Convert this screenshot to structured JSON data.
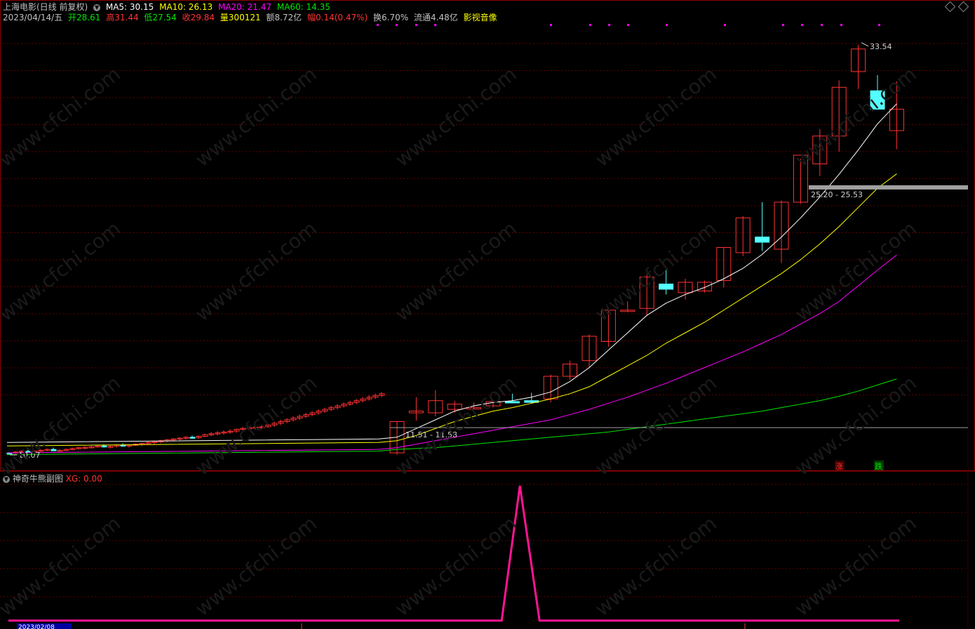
{
  "header": {
    "stock_name": "上海电影(日线 前复权)",
    "ma5": "MA5: 30.15",
    "ma10": "MA10: 26.13",
    "ma20": "MA20: 21.47",
    "ma60": "MA60: 14.35",
    "date": "2023/04/14/五",
    "open": "开28.61",
    "high": "高31.44",
    "low": "低27.54",
    "close": "收29.84",
    "volume": "量300121",
    "amount": "额8.72亿",
    "change": "幅0.14(0.47%)",
    "turnover": "换6.70%",
    "float": "流通4.48亿",
    "sector": "影视音像"
  },
  "sub_panel": {
    "title": "神奇牛熊副图",
    "xg": "XG: 0.00"
  },
  "annotations": {
    "high_mark": "33.54",
    "low_mark": "10.07",
    "zone1": "25.20 - 25.53",
    "zone2": "11.51 - 11.58",
    "up_tag": "涨",
    "down_tag": "跌"
  },
  "watermark": "www.cfchi.com",
  "colors": {
    "bg": "#000000",
    "up": "#ff3232",
    "down": "#54ffff",
    "ma5": "#ffffff",
    "ma10": "#ffff00",
    "ma20": "#ff00ff",
    "ma60": "#00e600",
    "grid": "#600000",
    "sub_line": "#ff1493"
  },
  "chart_data": {
    "type": "candlestick",
    "y_range": [
      9.5,
      34.5
    ],
    "candles": [
      [
        10.1,
        10.15,
        10.05,
        10.07
      ],
      [
        10.1,
        10.2,
        10.05,
        10.15
      ],
      [
        10.15,
        10.25,
        10.1,
        10.2
      ],
      [
        10.2,
        10.3,
        10.1,
        10.18
      ],
      [
        10.18,
        10.25,
        10.1,
        10.2
      ],
      [
        10.2,
        10.3,
        10.15,
        10.25
      ],
      [
        10.25,
        10.35,
        10.2,
        10.3
      ],
      [
        10.3,
        10.4,
        10.2,
        10.22
      ],
      [
        10.22,
        10.3,
        10.15,
        10.25
      ],
      [
        10.25,
        10.35,
        10.2,
        10.3
      ],
      [
        10.3,
        10.4,
        10.25,
        10.35
      ],
      [
        10.35,
        10.45,
        10.3,
        10.4
      ],
      [
        10.4,
        10.5,
        10.3,
        10.42
      ],
      [
        10.42,
        10.5,
        10.35,
        10.45
      ],
      [
        10.45,
        10.55,
        10.4,
        10.5
      ],
      [
        10.5,
        10.6,
        10.4,
        10.45
      ],
      [
        10.45,
        10.55,
        10.35,
        10.48
      ],
      [
        10.48,
        10.6,
        10.4,
        10.55
      ],
      [
        10.55,
        10.65,
        10.45,
        10.5
      ],
      [
        10.5,
        10.6,
        10.4,
        10.55
      ],
      [
        10.55,
        10.65,
        10.5,
        10.6
      ],
      [
        10.6,
        10.7,
        10.5,
        10.65
      ],
      [
        10.65,
        10.75,
        10.55,
        10.7
      ],
      [
        10.7,
        10.8,
        10.6,
        10.75
      ],
      [
        10.75,
        10.85,
        10.65,
        10.8
      ],
      [
        10.8,
        10.9,
        10.7,
        10.85
      ],
      [
        10.85,
        10.95,
        10.75,
        10.9
      ],
      [
        10.9,
        11.0,
        10.8,
        10.95
      ],
      [
        10.95,
        11.05,
        10.85,
        11.0
      ],
      [
        11.0,
        11.1,
        10.9,
        10.98
      ],
      [
        10.98,
        11.1,
        10.9,
        11.05
      ],
      [
        11.05,
        11.2,
        11.0,
        11.15
      ],
      [
        11.15,
        11.3,
        11.05,
        11.2
      ],
      [
        11.2,
        11.35,
        11.1,
        11.25
      ],
      [
        11.25,
        11.4,
        11.15,
        11.3
      ],
      [
        11.3,
        11.45,
        11.2,
        11.35
      ],
      [
        11.35,
        11.5,
        11.25,
        11.45
      ],
      [
        11.45,
        11.58,
        11.4,
        11.51
      ],
      [
        11.51,
        11.6,
        11.4,
        11.55
      ],
      [
        11.55,
        11.65,
        11.45,
        11.58
      ],
      [
        11.58,
        11.7,
        11.45,
        11.6
      ],
      [
        11.6,
        11.8,
        11.55,
        11.7
      ],
      [
        11.7,
        11.9,
        11.6,
        11.8
      ],
      [
        11.8,
        12.0,
        11.7,
        11.9
      ],
      [
        11.9,
        12.1,
        11.8,
        12.0
      ],
      [
        12.0,
        12.2,
        11.9,
        12.1
      ],
      [
        12.1,
        12.3,
        12.0,
        12.2
      ],
      [
        12.2,
        12.4,
        12.1,
        12.3
      ],
      [
        12.3,
        12.5,
        12.2,
        12.4
      ],
      [
        12.4,
        12.6,
        12.3,
        12.5
      ],
      [
        12.5,
        12.7,
        12.4,
        12.6
      ],
      [
        12.6,
        12.8,
        12.5,
        12.7
      ],
      [
        12.7,
        12.9,
        12.6,
        12.8
      ],
      [
        12.8,
        13.0,
        12.7,
        12.9
      ],
      [
        12.9,
        13.1,
        12.8,
        13.0
      ],
      [
        13.0,
        13.2,
        12.9,
        13.1
      ],
      [
        13.1,
        13.3,
        13.0,
        13.2
      ],
      [
        13.2,
        13.4,
        13.1,
        13.3
      ],
      [
        13.3,
        13.5,
        13.2,
        13.4
      ],
      [
        13.4,
        13.6,
        13.3,
        13.5
      ]
    ],
    "candles_main": [
      [
        10.1,
        11.9,
        10.0,
        11.9
      ],
      [
        12.4,
        13.3,
        11.95,
        12.5
      ],
      [
        12.4,
        13.7,
        12.2,
        13.1
      ],
      [
        12.6,
        13.1,
        12.4,
        12.9
      ],
      [
        12.7,
        13.0,
        12.6,
        12.7
      ],
      [
        12.8,
        13.1,
        12.7,
        13.05
      ],
      [
        13.05,
        13.5,
        12.95,
        13.0
      ],
      [
        13.1,
        13.55,
        12.95,
        13.0
      ],
      [
        13.2,
        14.6,
        13.0,
        14.5
      ],
      [
        14.5,
        15.4,
        14.3,
        15.2
      ],
      [
        15.4,
        16.9,
        15.0,
        16.8
      ],
      [
        16.5,
        18.4,
        16.2,
        18.3
      ],
      [
        18.3,
        18.8,
        18.2,
        18.3
      ],
      [
        18.4,
        20.4,
        18.0,
        20.2
      ],
      [
        19.8,
        20.6,
        19.2,
        19.5
      ],
      [
        19.3,
        20.1,
        18.9,
        19.9
      ],
      [
        19.4,
        20.0,
        19.3,
        19.9
      ],
      [
        20.0,
        21.9,
        19.6,
        21.9
      ],
      [
        21.6,
        23.7,
        21.4,
        23.6
      ],
      [
        22.5,
        24.5,
        21.7,
        22.2
      ],
      [
        21.8,
        24.6,
        21.0,
        24.5
      ],
      [
        24.5,
        27.0,
        24.4,
        27.2
      ],
      [
        26.7,
        28.7,
        26.0,
        28.3
      ],
      [
        28.3,
        31.5,
        27.4,
        31.1
      ],
      [
        32.0,
        33.54,
        31.0,
        33.3
      ],
      [
        30.9,
        31.8,
        30.9,
        29.84
      ],
      [
        28.61,
        31.44,
        27.54,
        29.84
      ]
    ],
    "ma5": [
      11.0,
      11.5,
      12.0,
      12.5,
      12.8,
      13.0,
      13.1,
      13.3,
      13.6,
      14.2,
      15.0,
      16.0,
      17.0,
      18.0,
      18.7,
      19.2,
      19.6,
      20.1,
      20.7,
      21.5,
      22.5,
      23.6,
      24.8,
      26.1,
      27.5,
      29.0,
      30.15
    ],
    "ma10": [
      10.8,
      11.1,
      11.5,
      11.9,
      12.2,
      12.5,
      12.7,
      12.95,
      13.2,
      13.5,
      13.9,
      14.5,
      15.1,
      15.7,
      16.4,
      17.0,
      17.6,
      18.3,
      19.0,
      19.7,
      20.4,
      21.2,
      22.1,
      23.1,
      24.2,
      25.3,
      26.13
    ],
    "ma20": [
      10.4,
      10.6,
      10.8,
      11.0,
      11.2,
      11.4,
      11.6,
      11.8,
      12.0,
      12.3,
      12.6,
      12.95,
      13.3,
      13.7,
      14.1,
      14.55,
      15.0,
      15.45,
      15.9,
      16.4,
      16.9,
      17.5,
      18.1,
      18.8,
      19.7,
      20.6,
      21.47
    ],
    "ma60": [
      10.3,
      10.35,
      10.4,
      10.5,
      10.6,
      10.7,
      10.8,
      10.9,
      11.0,
      11.1,
      11.2,
      11.3,
      11.45,
      11.6,
      11.75,
      11.9,
      12.05,
      12.2,
      12.35,
      12.5,
      12.7,
      12.9,
      13.1,
      13.35,
      13.65,
      14.0,
      14.35
    ],
    "sub_series": {
      "name": "XG",
      "peak_index": 23,
      "peak_value": 1,
      "values_note_x": [
        "2023/02/08"
      ]
    }
  }
}
